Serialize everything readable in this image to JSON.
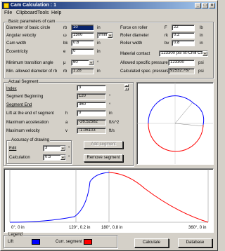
{
  "window": {
    "title": "Cam Calculation : 1"
  },
  "menu": [
    "File",
    "Clipboard",
    "Tools",
    "Help"
  ],
  "basic": {
    "title": "Basic parameters of cam",
    "rows": [
      {
        "label": "Diameter of basic circle",
        "symbol": "rb",
        "value": "10",
        "unit": "in"
      },
      {
        "label": "Angular velocity",
        "symbol": "ω",
        "value": "1500",
        "unit": "/min"
      },
      {
        "label": "Cam width",
        "symbol": "bk",
        "value": "0.8",
        "unit": "in"
      },
      {
        "label": "Eccentricity",
        "symbol": "e",
        "value": "0",
        "unit": "in"
      },
      {
        "label": "Minimum transition angle",
        "symbol": "μ",
        "value": "60",
        "unit": "°"
      },
      {
        "label": "Min. allowed diameter of rb",
        "symbol": "rb",
        "value": "1.28",
        "unit": "in"
      }
    ],
    "right_rows": [
      {
        "label": "Force on roller",
        "symbol": "F",
        "value": "22",
        "unit": "lb"
      },
      {
        "label": "Roller diameter",
        "symbol": "rk",
        "value": "0.2",
        "unit": "in"
      },
      {
        "label": "Roller width",
        "symbol": "bv",
        "value": "0.8",
        "unit": "in"
      },
      {
        "label": "Material contact",
        "symbol": "",
        "value": "123300 psi St-Chill Cast",
        "unit": ""
      },
      {
        "label": "Allowed specific pressure",
        "symbol": "",
        "value": "123300",
        "unit": "psi"
      },
      {
        "label": "Calculated spec. pressure",
        "symbol": "",
        "value": "92532.767",
        "unit": "psi"
      }
    ]
  },
  "segment": {
    "title": "Actual Segment",
    "index_label": "Index",
    "index_value": "3",
    "begin_label": "Segment Beginning",
    "begin_value": "120",
    "begin_unit": "°",
    "end_label": "Segment End",
    "end_value": "360",
    "end_unit": "°",
    "lift_label": "Lift at the end of segment",
    "lift_symbol": "h",
    "lift_value": "0",
    "lift_unit": "in",
    "acc_label": "Maximum acceleration",
    "acc_symbol": "a",
    "acc_value": "-26.52582",
    "acc_unit": "ft/s^2",
    "vel_label": "Maximum velocity",
    "vel_symbol": "v",
    "vel_value": "-1.06103",
    "vel_unit": "ft/s"
  },
  "accuracy": {
    "title": "Accuracy of drawing",
    "edit_label": "Edit",
    "edit_value": "3",
    "edit_unit": "°",
    "calc_label": "Calculation",
    "calc_value": "0.5",
    "calc_unit": "°"
  },
  "buttons": {
    "add": "Add segment",
    "remove": "Remove segment",
    "calculate": "Calculate",
    "database": "Database"
  },
  "graph": {
    "xlabels": [
      "0°, 0 in",
      "120°, 0.2 in",
      "180°, 0.8 in",
      "360°, 0 in"
    ],
    "colors": {
      "lift": "#0000ff",
      "segment": "#ff0000"
    }
  },
  "legend": {
    "title": "Legend",
    "lift": "Lift",
    "segment": "Curr. segment"
  }
}
